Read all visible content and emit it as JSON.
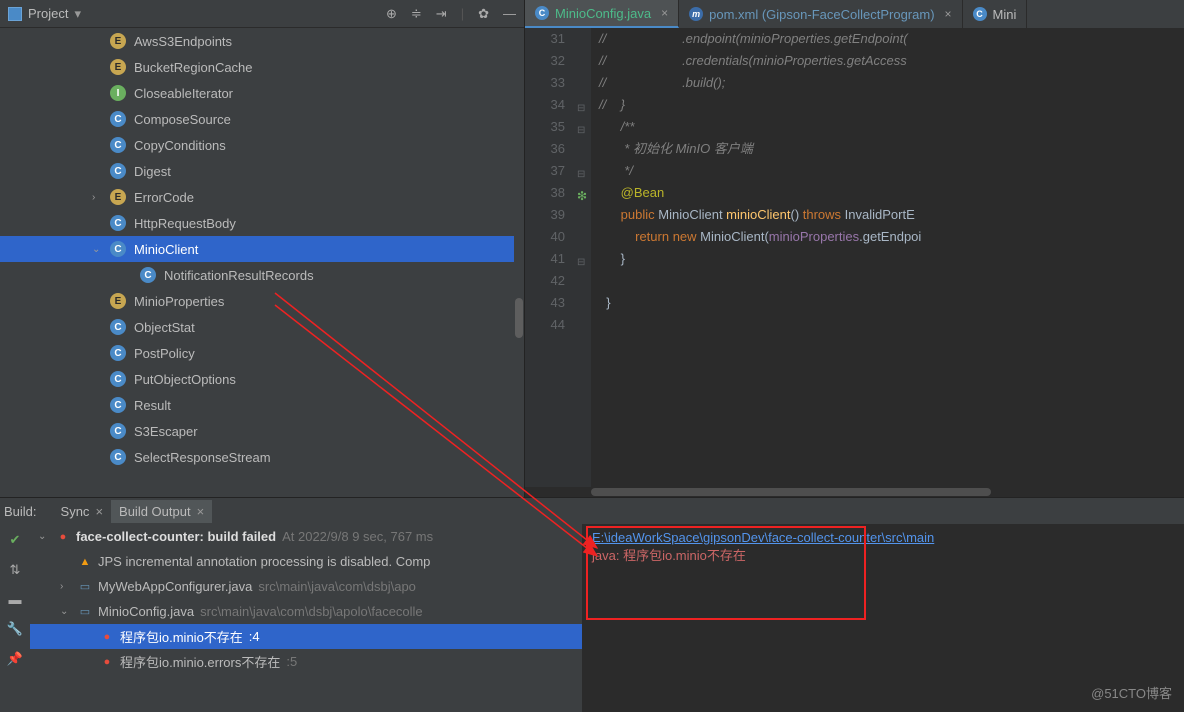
{
  "sidebar": {
    "title": "Project",
    "items": [
      {
        "icon": "e",
        "label": "AwsS3Endpoints"
      },
      {
        "icon": "e",
        "label": "BucketRegionCache"
      },
      {
        "icon": "i",
        "label": "CloseableIterator"
      },
      {
        "icon": "c",
        "label": "ComposeSource"
      },
      {
        "icon": "c",
        "label": "CopyConditions"
      },
      {
        "icon": "c",
        "label": "Digest"
      },
      {
        "icon": "e",
        "label": "ErrorCode",
        "expander": "›"
      },
      {
        "icon": "c",
        "label": "HttpRequestBody"
      },
      {
        "icon": "c",
        "label": "MinioClient",
        "expander": "⌄",
        "selected": true
      },
      {
        "icon": "c",
        "label": "NotificationResultRecords",
        "child": true
      },
      {
        "icon": "e",
        "label": "MinioProperties"
      },
      {
        "icon": "c",
        "label": "ObjectStat"
      },
      {
        "icon": "c",
        "label": "PostPolicy"
      },
      {
        "icon": "c",
        "label": "PutObjectOptions"
      },
      {
        "icon": "c",
        "label": "Result"
      },
      {
        "icon": "c",
        "label": "S3Escaper"
      },
      {
        "icon": "c",
        "label": "SelectResponseStream"
      }
    ]
  },
  "tabs": [
    {
      "icon": "C",
      "label": "MinioConfig.java",
      "active": true,
      "color": "#4dbb8a"
    },
    {
      "icon": "m",
      "iconClass": "m",
      "label": "pom.xml (Gipson-FaceCollectProgram)",
      "color": "#6897bb"
    },
    {
      "icon": "C",
      "label": "Mini",
      "partial": true
    }
  ],
  "code": {
    "start": 31,
    "lines": [
      {
        "n": 31,
        "html": "<span class='c-comment'>//                     .endpoint(minioProperties.getEndpoint(</span>"
      },
      {
        "n": 32,
        "html": "<span class='c-comment'>//                     .credentials(minioProperties.getAccess</span>"
      },
      {
        "n": 33,
        "html": "<span class='c-comment'>//                     .build();</span>"
      },
      {
        "n": 34,
        "html": "<span class='c-comment'>//    }</span>",
        "fold": "⊟"
      },
      {
        "n": 35,
        "html": "      <span class='c-comment'>/**</span>",
        "fold": "⊟"
      },
      {
        "n": 36,
        "html": "       <span class='c-comment'>* 初始化 MinIO 客户端</span>"
      },
      {
        "n": 37,
        "html": "       <span class='c-comment'>*/</span>",
        "fold": "⊟"
      },
      {
        "n": 38,
        "html": "      <span class='c-ann'>@Bean</span>",
        "bean": true
      },
      {
        "n": 39,
        "html": "      <span class='c-kw'>public</span> MinioClient <span class='c-method'>minioClient</span>() <span class='c-kw'>throws</span> InvalidPortE"
      },
      {
        "n": 40,
        "html": "          <span class='c-kw'>return new</span> MinioClient(<span class='c-field'>minioProperties</span>.getEndpoi"
      },
      {
        "n": 41,
        "html": "      }",
        "fold": "⊟"
      },
      {
        "n": 42,
        "html": ""
      },
      {
        "n": 43,
        "html": "  }"
      },
      {
        "n": 44,
        "html": ""
      }
    ]
  },
  "build": {
    "label": "Build:",
    "tabs": [
      {
        "label": "Sync",
        "active": false
      },
      {
        "label": "Build Output",
        "active": true
      }
    ],
    "rows": [
      {
        "indent": 0,
        "exp": "⌄",
        "icon": "err",
        "bold": "face-collect-counter: build failed",
        "meta": " At 2022/9/8 9 sec, 767 ms"
      },
      {
        "indent": 1,
        "icon": "warn",
        "txt": "JPS incremental annotation processing is disabled. Comp"
      },
      {
        "indent": 1,
        "exp": "›",
        "icon": "file",
        "txt": "MyWebAppConfigurer.java",
        "meta": " src\\main\\java\\com\\dsbj\\apo"
      },
      {
        "indent": 1,
        "exp": "⌄",
        "icon": "file",
        "txt": "MinioConfig.java",
        "meta": " src\\main\\java\\com\\dsbj\\apolo\\facecolle"
      },
      {
        "indent": 2,
        "icon": "err",
        "txt": "程序包io.minio不存在",
        "meta": " :4",
        "sel": true
      },
      {
        "indent": 2,
        "icon": "err",
        "txt": "程序包io.minio.errors不存在",
        "meta": " :5"
      }
    ],
    "detail": {
      "path": "E:\\ideaWorkSpace\\gipsonDev\\face-collect-counter\\src\\main",
      "err": "java: 程序包io.minio不存在"
    }
  },
  "watermark": "@51CTO博客"
}
